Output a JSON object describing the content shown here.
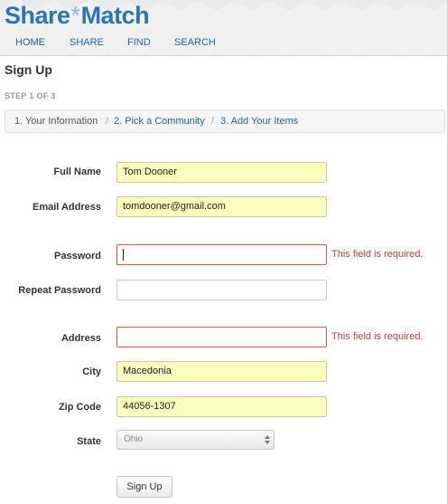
{
  "header": {
    "logo_part1": "Share",
    "logo_star": "*",
    "logo_part2": "Match",
    "nav": [
      {
        "label": "HOME"
      },
      {
        "label": "SHARE"
      },
      {
        "label": "FIND"
      },
      {
        "label": "SEARCH"
      }
    ],
    "brand_color": "#2a74b8",
    "link_color": "#1d63b0"
  },
  "page": {
    "title": "Sign Up",
    "step": "STEP 1 OF 3"
  },
  "breadcrumb": {
    "items": [
      {
        "label": "1. Your Information"
      },
      {
        "label": "2. Pick a Community"
      },
      {
        "label": "3. Add Your Items"
      }
    ],
    "separator": "/"
  },
  "form": {
    "full_name": {
      "label": "Full Name",
      "value": "Tom Dooner"
    },
    "email": {
      "label": "Email Address",
      "value": "tomdooner@gmail.com"
    },
    "password": {
      "label": "Password",
      "value": "",
      "error": "This field is required."
    },
    "repeat_password": {
      "label": "Repeat Password",
      "value": ""
    },
    "address": {
      "label": "Address",
      "value": "",
      "error": "This field is required."
    },
    "city": {
      "label": "City",
      "value": "Macedonia"
    },
    "zip": {
      "label": "Zip Code",
      "value": "44056-1307"
    },
    "state": {
      "label": "State",
      "value": "Ohio"
    },
    "submit_label": "Sign Up",
    "error_color": "#b84040",
    "autofill_color": "#fcfcbf"
  }
}
